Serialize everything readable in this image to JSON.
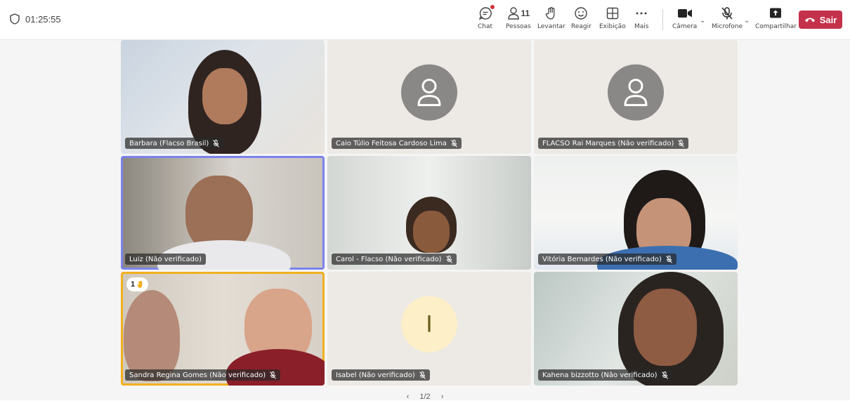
{
  "header": {
    "elapsed_time": "01:25:55"
  },
  "toolbar": {
    "chat_label": "Chat",
    "people_label": "Pessoas",
    "people_count": "11",
    "raise_label": "Levantar",
    "react_label": "Reagir",
    "view_label": "Exibição",
    "more_label": "Mais",
    "camera_label": "Câmera",
    "mic_label": "Microfone",
    "share_label": "Compartilhar",
    "leave_label": "Sair",
    "leave_color": "#c4314b"
  },
  "participants": [
    {
      "name": "Barbara (Flacso Brasil)",
      "video": true,
      "muted": true
    },
    {
      "name": "Caio Túlio Feitosa Cardoso Lima",
      "video": false,
      "avatar": "person-icon",
      "muted": true
    },
    {
      "name": "FLACSO Rai Marques (Não verificado)",
      "video": false,
      "avatar": "person-icon",
      "muted": true
    },
    {
      "name": "Luiz (Não verificado)",
      "video": true,
      "speaking": true,
      "muted": false
    },
    {
      "name": "Carol - Flacso (Não verificado)",
      "video": true,
      "muted": true
    },
    {
      "name": "Vitória Bernardes (Não verificado)",
      "video": true,
      "muted": true
    },
    {
      "name": "Sandra Regina Gomes (Não verificado)",
      "video": true,
      "muted": true,
      "raised_hand": "1"
    },
    {
      "name": "Isabel (Não verificado)",
      "video": false,
      "avatar_letter": "I",
      "muted": true
    },
    {
      "name": "Kahena bizzotto (Não verificado)",
      "video": true,
      "muted": true
    }
  ],
  "pagination": {
    "page": "1/2",
    "prev": "‹",
    "next": "›"
  }
}
